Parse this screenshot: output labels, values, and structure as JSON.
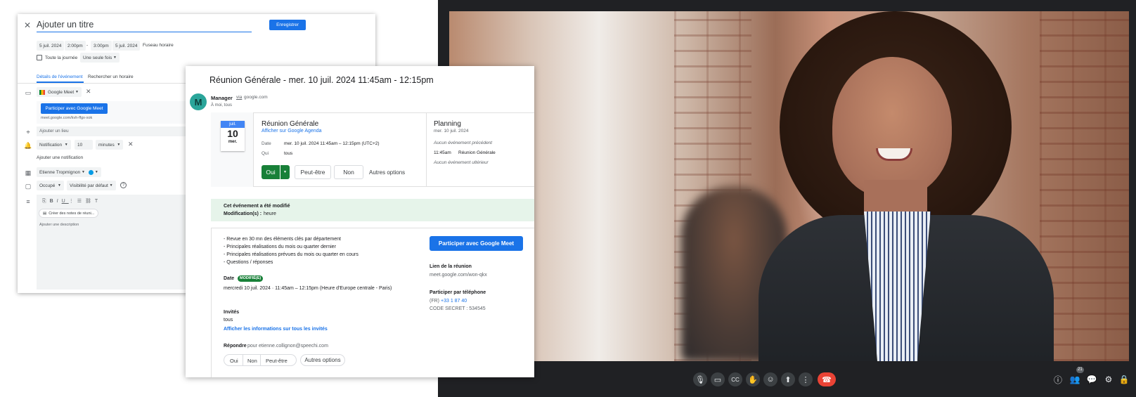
{
  "calendar": {
    "close_icon": "close-icon",
    "title_placeholder": "Ajouter un titre",
    "save_label": "Enregistrer",
    "start_date": "5 juil. 2024",
    "start_time": "2:00pm",
    "separator": "-",
    "end_time": "3:00pm",
    "end_date": "5 juil. 2024",
    "timezone": "Fuseau horaire",
    "all_day_label": "Toute la journée",
    "repeat": "Une seule fois",
    "tab_details": "Détails de l'événement",
    "tab_find_time": "Rechercher un horaire",
    "conference": "Google Meet",
    "join_meet": "Participer avec Google Meet",
    "meet_link": "meet.google.com/kvh-ffgx-xok",
    "location_placeholder": "Ajouter un lieu",
    "notification_type": "Notification",
    "notification_value": "10",
    "notification_unit": "minutes",
    "add_notification": "Ajouter une notification",
    "calendar_owner": "Etienne Tropmignon",
    "busy": "Occupé",
    "visibility": "Visibilité par défaut",
    "meeting_notes": "Créer des notes de réuni...",
    "description_placeholder": "Ajouter une description"
  },
  "mail": {
    "subject": "Réunion Générale - mer. 10 juil. 2024 11:45am - 12:15pm",
    "avatar_letter": "M",
    "sender": "Manager",
    "via": "via",
    "via_domain": "google.com",
    "recipients": "À moi, tous",
    "date_month": "juil.",
    "date_day": "10",
    "date_weekday": "mer.",
    "event_title": "Réunion Générale",
    "show_in_calendar": "Afficher sur Google Agenda",
    "when_label": "Date",
    "when_value": "mer. 10 juil. 2024 11:45am – 12:15pm (UTC+2)",
    "who_label": "Qui",
    "who_value": "tous",
    "rsvp_yes": "Oui",
    "rsvp_maybe": "Peut-être",
    "rsvp_no": "Non",
    "more_options": "Autres options",
    "planning_title": "Planning",
    "planning_date": "mer. 10 juil. 2024",
    "no_previous": "Aucun événement précédent",
    "planning_time": "11:45am",
    "planning_event": "Réunion Générale",
    "no_next": "Aucun événement ultérieur",
    "modified_title": "Cet événement a été modifié",
    "modified_label": "Modification(s) :",
    "modified_value": "heure",
    "agenda": [
      "- Revue en 30 mn des éléments clés par département",
      "- Principales réalisations du mois ou quarter dernier",
      "- Principales réalisations prévues du mois ou quarter en cours",
      "- Questions / réponses"
    ],
    "date_heading": "Date",
    "modified_badge": "MODIFIÉ(E)",
    "date_full": "mercredi 10 juil. 2024 · 11:45am – 12:15pm (Heure d'Europe centrale - Paris)",
    "guests_heading": "Invités",
    "guests_value": "tous",
    "show_all_guests": "Afficher les informations sur tous les invités",
    "reply_heading": "Répondre",
    "reply_for": "pour etienne.collignon@speechi.com",
    "reply_yes": "Oui",
    "reply_no": "Non",
    "reply_maybe": "Peut-être",
    "reply_more": "Autres options",
    "join_meet_button": "Participer avec Google Meet",
    "meeting_link_heading": "Lien de la réunion",
    "meeting_link_value": "meet.google.com/won-qkx",
    "phone_heading": "Participer par téléphone",
    "phone_prefix": "(FR)",
    "phone_number": "+33 1 87 40",
    "phone_code": "CODE SECRET : 534545"
  },
  "meet": {
    "participants_badge": "21",
    "colors": {
      "end_call": "#ea4335",
      "toolbar_bg": "#202124",
      "button_bg": "#3c4043"
    }
  },
  "colors": {
    "blue": "#1a73e8",
    "green": "#188038",
    "modified_bg": "#e6f4ea"
  }
}
